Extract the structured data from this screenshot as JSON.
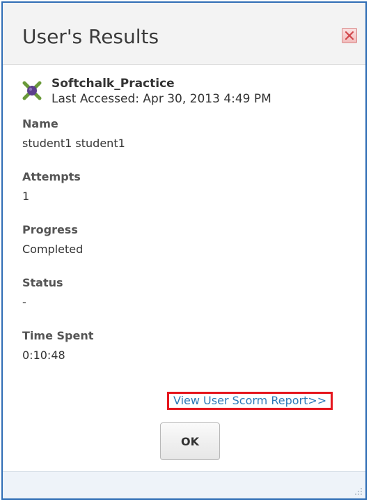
{
  "dialog": {
    "title": "User's Results",
    "close_icon": "close-icon",
    "close_color": "#e07a7a"
  },
  "item": {
    "name": "Softchalk_Practice",
    "last_accessed": "Last Accessed: Apr 30, 2013 4:49 PM",
    "icon": "scorm-package-icon"
  },
  "fields": [
    {
      "label": "Name",
      "value": "student1 student1"
    },
    {
      "label": "Attempts",
      "value": "1"
    },
    {
      "label": "Progress",
      "value": "Completed"
    },
    {
      "label": "Status",
      "value": "-"
    },
    {
      "label": "Time Spent",
      "value": "0:10:48"
    }
  ],
  "report_link": {
    "label": "View User Scorm Report>>",
    "color": "#2c79b8",
    "highlight_color": "#e5151d"
  },
  "buttons": {
    "ok_label": "OK"
  },
  "colors": {
    "border": "#2f6db5",
    "titlebar_bg": "#f3f3f3",
    "footer_bg": "#eef3f9"
  }
}
